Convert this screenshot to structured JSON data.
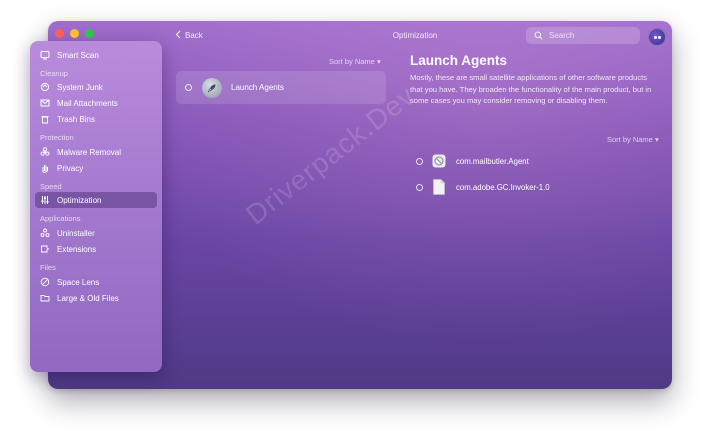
{
  "window": {
    "title": "Optimization"
  },
  "topbar": {
    "back_label": "Back",
    "search_placeholder": "Search"
  },
  "sidebar": {
    "top_item": {
      "label": "Smart Scan",
      "icon": "smart-scan-icon"
    },
    "sections": [
      {
        "title": "Cleanup",
        "items": [
          {
            "label": "System Junk",
            "icon": "system-junk-icon"
          },
          {
            "label": "Mail Attachments",
            "icon": "mail-icon"
          },
          {
            "label": "Trash Bins",
            "icon": "trash-icon"
          }
        ]
      },
      {
        "title": "Protection",
        "items": [
          {
            "label": "Malware Removal",
            "icon": "biohazard-icon"
          },
          {
            "label": "Privacy",
            "icon": "hand-icon"
          }
        ]
      },
      {
        "title": "Speed",
        "items": [
          {
            "label": "Optimization",
            "icon": "sliders-icon",
            "active": true
          }
        ]
      },
      {
        "title": "Applications",
        "items": [
          {
            "label": "Uninstaller",
            "icon": "uninstaller-icon"
          },
          {
            "label": "Extensions",
            "icon": "extensions-icon"
          }
        ]
      },
      {
        "title": "Files",
        "items": [
          {
            "label": "Space Lens",
            "icon": "space-lens-icon"
          },
          {
            "label": "Large & Old Files",
            "icon": "folder-icon"
          }
        ]
      }
    ]
  },
  "middle": {
    "sort_label": "Sort by Name",
    "items": [
      {
        "label": "Launch Agents",
        "icon": "rocket-icon",
        "selected": false
      }
    ]
  },
  "right": {
    "title": "Launch Agents",
    "description": "Mostly, these are small satellite applications of other software products that you have. They broaden the functionality of the main product, but in some cases you may consider removing or disabling them.",
    "sort_label": "Sort by Name",
    "agents": [
      {
        "label": "com.mailbutler.Agent",
        "icon": "disabled-app-icon"
      },
      {
        "label": "com.adobe.GC.Invoker-1.0",
        "icon": "document-icon"
      }
    ]
  },
  "watermark": {
    "text": "Driverpack.Dev"
  },
  "colors": {
    "window_top": "#a06dcc",
    "window_bottom": "#4f3a86",
    "sidebar": "#a57ad0",
    "close": "#ff5f57",
    "minimize": "#febc2e",
    "zoom": "#28c840"
  }
}
